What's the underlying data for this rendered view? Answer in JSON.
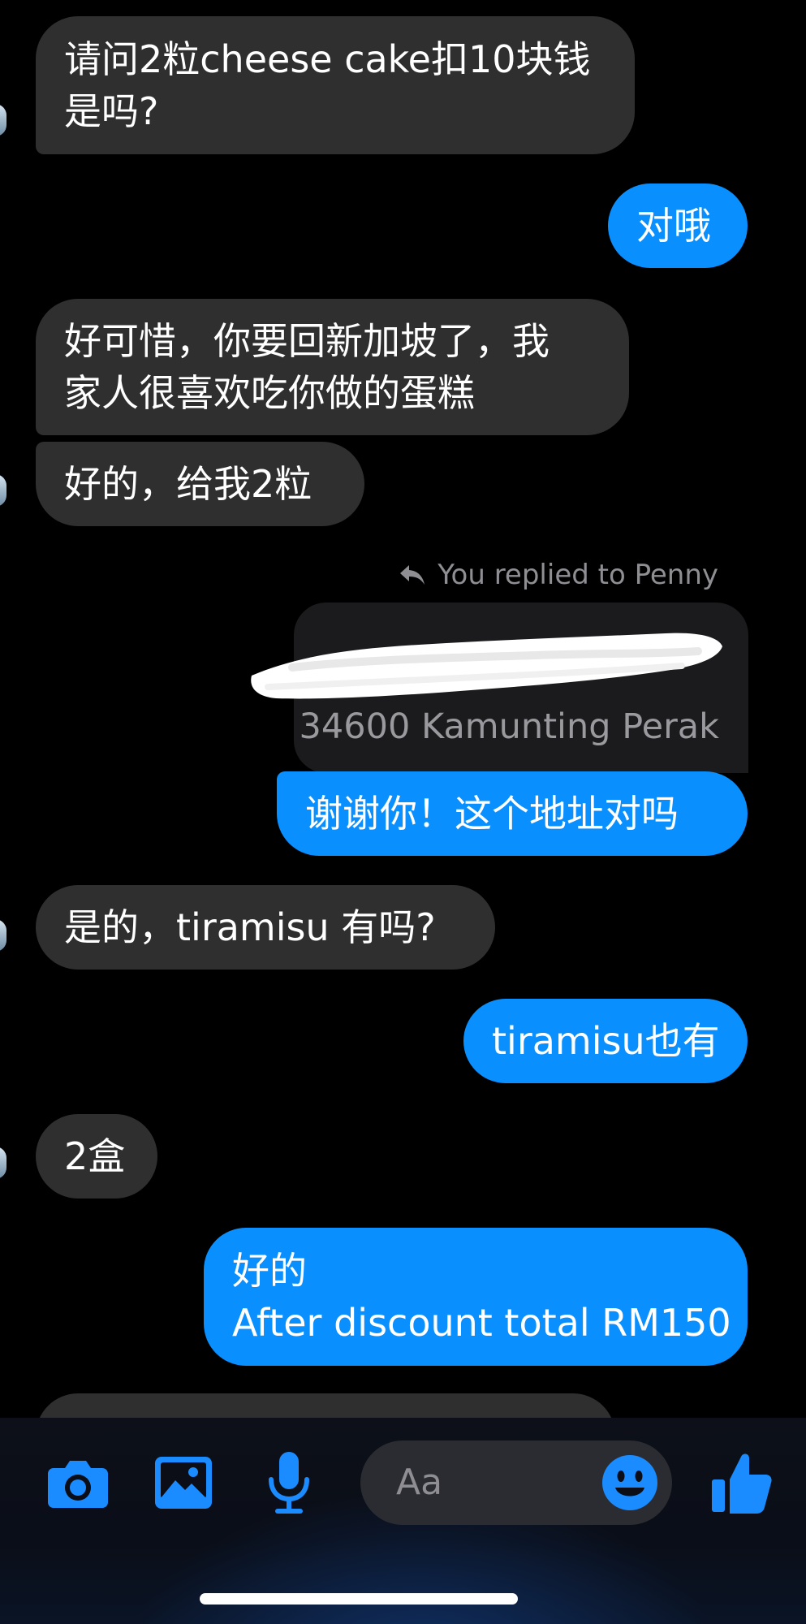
{
  "colors": {
    "background": "#000000",
    "incoming_bubble": "#2f2f2f",
    "outgoing_bubble": "#0a8fff",
    "accent_icon": "#1a8cff",
    "secondary_text": "#8e8e93"
  },
  "messages": [
    {
      "side": "in",
      "lines": [
        "请问2粒cheese cake扣10块钱",
        "是吗?"
      ]
    },
    {
      "side": "out",
      "lines": [
        "对哦"
      ]
    },
    {
      "side": "in",
      "lines": [
        "好可惜，你要回新加坡了，我",
        "家人很喜欢吃你做的蛋糕"
      ]
    },
    {
      "side": "in",
      "lines": [
        "好的，给我2粒"
      ]
    },
    {
      "side": "out",
      "reply_header": "You replied to Penny",
      "reply_icon": "reply-arrow-icon",
      "quoted_text": "34600 Kamunting Perak",
      "lines": [
        "谢谢你！这个地址对吗"
      ]
    },
    {
      "side": "in",
      "lines": [
        "是的，tiramisu 有吗?"
      ]
    },
    {
      "side": "out",
      "lines": [
        "tiramisu也有"
      ]
    },
    {
      "side": "in",
      "lines": [
        "2盒"
      ]
    },
    {
      "side": "out",
      "lines": [
        "好的",
        "After discount total RM150"
      ]
    }
  ],
  "composer": {
    "placeholder": "Aa",
    "icons": [
      "camera-icon",
      "photo-icon",
      "microphone-icon",
      "emoji-icon",
      "thumbs-up-icon"
    ]
  }
}
